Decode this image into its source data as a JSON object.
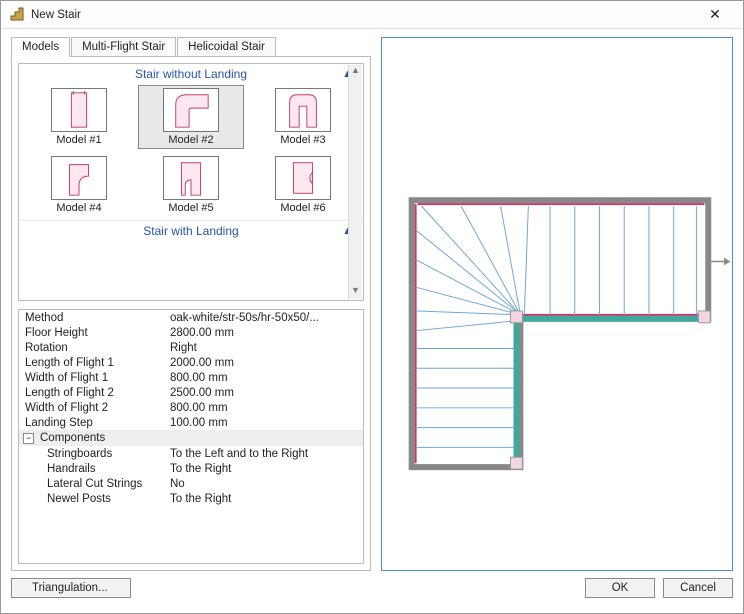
{
  "window": {
    "title": "New Stair"
  },
  "tabs": {
    "t0": "Models",
    "t1": "Multi-Flight Stair",
    "t2": "Helicoidal Stair"
  },
  "groups": {
    "g0": "Stair without Landing",
    "g1": "Stair with Landing"
  },
  "models": {
    "m0": "Model #1",
    "m1": "Model #2",
    "m2": "Model #3",
    "m3": "Model #4",
    "m4": "Model #5",
    "m5": "Model #6"
  },
  "props": {
    "r0": {
      "k": "Method",
      "v": "oak-white/str-50s/hr-50x50/..."
    },
    "r1": {
      "k": "Floor Height",
      "v": "2800.00 mm"
    },
    "r2": {
      "k": "Rotation",
      "v": "Right"
    },
    "r3": {
      "k": "Length of Flight 1",
      "v": "2000.00 mm"
    },
    "r4": {
      "k": "Width of Flight 1",
      "v": "800.00 mm"
    },
    "r5": {
      "k": "Length of Flight 2",
      "v": "2500.00 mm"
    },
    "r6": {
      "k": "Width of Flight 2",
      "v": "800.00 mm"
    },
    "r7": {
      "k": "Landing Step",
      "v": "100.00 mm"
    },
    "group_components": "Components",
    "r8": {
      "k": "Stringboards",
      "v": "To the Left and to the Right"
    },
    "r9": {
      "k": "Handrails",
      "v": "To the Right"
    },
    "r10": {
      "k": "Lateral Cut Strings",
      "v": "No"
    },
    "r11": {
      "k": "Newel Posts",
      "v": "To the Right"
    }
  },
  "buttons": {
    "triangulation": "Triangulation...",
    "ok": "OK",
    "cancel": "Cancel"
  },
  "glyphs": {
    "chev_up": "▲",
    "minus": "−",
    "close": "✕",
    "arrow_up": "▲",
    "arrow_dn": "▼"
  }
}
